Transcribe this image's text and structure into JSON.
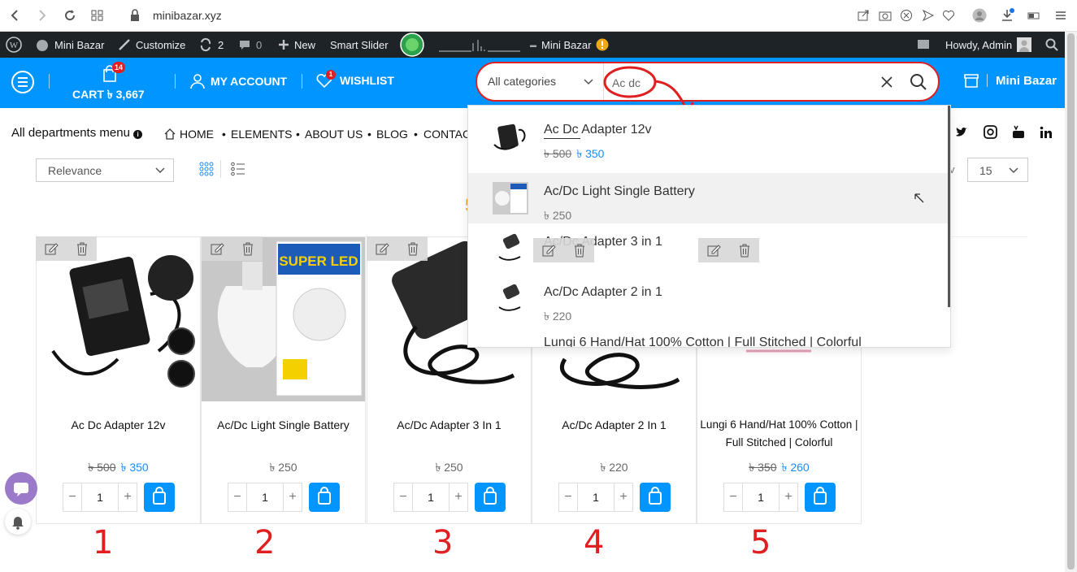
{
  "browser": {
    "url": "minibazar.xyz"
  },
  "adminbar": {
    "site_name": "Mini Bazar",
    "customize": "Customize",
    "updates_count": "2",
    "comments_count": "0",
    "new_label": "New",
    "smart_slider": "Smart Slider",
    "site_name_2": "Mini Bazar",
    "howdy": "Howdy, Admin"
  },
  "header": {
    "cart_label": "CART",
    "cart_total": "৳ 3,667",
    "cart_count": "14",
    "account_label": "MY ACCOUNT",
    "wishlist_label": "WISHLIST",
    "wishlist_count": "1",
    "store_label": "Mini Bazar"
  },
  "search": {
    "category": "All categories",
    "query": "Ac dc"
  },
  "nav": {
    "departments": "All departments menu",
    "items": [
      "HOME",
      "ELEMENTS",
      "ABOUT US",
      "BLOG",
      "CONTACT"
    ]
  },
  "toolbar": {
    "sort": "Relevance",
    "per_page": "15",
    "results_fragment": "5"
  },
  "products": [
    {
      "name": "Ac Dc Adapter 12v",
      "old_price": "৳ 500",
      "price": "৳ 350",
      "qty": "1"
    },
    {
      "name": "Ac/Dc Light Single Battery",
      "old_price": "",
      "price": "৳ 250",
      "qty": "1"
    },
    {
      "name": "Ac/Dc Adapter 3 In 1",
      "old_price": "",
      "price": "৳ 250",
      "qty": "1"
    },
    {
      "name": "Ac/Dc Adapter 2 In 1",
      "old_price": "",
      "price": "৳ 220",
      "qty": "1"
    },
    {
      "name": "Lungi 6 Hand/Hat 100% Cotton | Full Stitched | Colorful",
      "old_price": "৳ 350",
      "price": "৳ 260",
      "qty": "1"
    }
  ],
  "suggestions": [
    {
      "name": "Ac Dc Adapter 12v",
      "old_price": "৳ 500",
      "price": "৳ 350"
    },
    {
      "name": "Ac/Dc Light Single Battery",
      "old_price": "",
      "price": "৳ 250"
    },
    {
      "name": "Ac/Dc Adapter 3 in 1",
      "old_price": "",
      "price": ""
    },
    {
      "name": "Ac/Dc Adapter 2 in 1",
      "old_price": "",
      "price": "৳ 220"
    },
    {
      "name": "Lungi 6 Hand/Hat 100% Cotton | Full Stitched | Colorful",
      "old_price": "",
      "price": ""
    }
  ],
  "annotations": [
    "1",
    "2",
    "3",
    "4",
    "5"
  ],
  "colors": {
    "accent": "#0095ff",
    "annotation": "#e02020",
    "adminbar": "#1d2327"
  }
}
